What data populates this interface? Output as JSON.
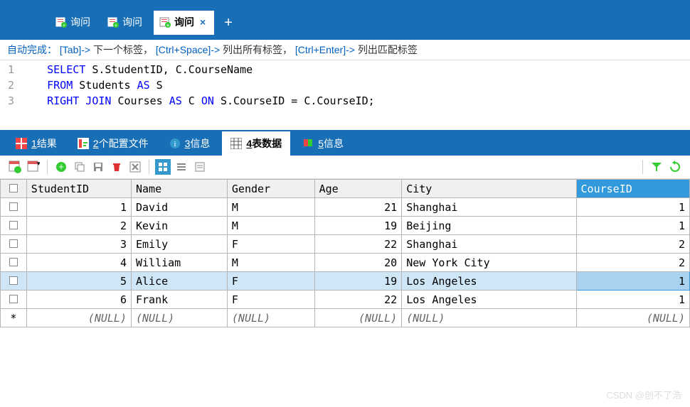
{
  "tabs": [
    {
      "label": "询问",
      "active": false
    },
    {
      "label": "询问",
      "active": false
    },
    {
      "label": "询问",
      "active": true
    }
  ],
  "hint": {
    "prefix": "自动完成：",
    "t1": "[Tab]->",
    "l1": " 下一个标签，",
    "t2": "[Ctrl+Space]->",
    "l2": " 列出所有标签，",
    "t3": "[Ctrl+Enter]->",
    "l3": " 列出匹配标签"
  },
  "sql": {
    "line1": {
      "kw1": "SELECT",
      "rest": " S.StudentID, C.CourseName"
    },
    "line2": {
      "kw1": "FROM",
      "mid": " Students ",
      "kw2": "AS",
      "rest": " S"
    },
    "line3": {
      "kw1": "RIGHT JOIN",
      "mid": " Courses ",
      "kw2": "AS",
      "mid2": " C ",
      "kw3": "ON",
      "rest": " S.CourseID = C.CourseID;"
    }
  },
  "result_tabs": {
    "t1": {
      "num": "1",
      "label": " 结果"
    },
    "t2": {
      "num": "2",
      "label": " 个配置文件"
    },
    "t3": {
      "num": "3",
      "label": " 信息"
    },
    "t4": {
      "num": "4",
      "label": " 表数据"
    },
    "t5": {
      "num": "5",
      "label": " 信息"
    }
  },
  "columns": {
    "c1": "StudentID",
    "c2": "Name",
    "c3": "Gender",
    "c4": "Age",
    "c5": "City",
    "c6": "CourseID"
  },
  "rows": [
    {
      "id": "1",
      "name": "David",
      "gender": "M",
      "age": "21",
      "city": "Shanghai",
      "course": "1",
      "sel": false
    },
    {
      "id": "2",
      "name": "Kevin",
      "gender": "M",
      "age": "19",
      "city": "Beijing",
      "course": "1",
      "sel": false
    },
    {
      "id": "3",
      "name": "Emily",
      "gender": "F",
      "age": "22",
      "city": "Shanghai",
      "course": "2",
      "sel": false
    },
    {
      "id": "4",
      "name": "William",
      "gender": "M",
      "age": "20",
      "city": "New York City",
      "course": "2",
      "sel": false
    },
    {
      "id": "5",
      "name": "Alice",
      "gender": "F",
      "age": "19",
      "city": "Los Angeles",
      "course": "1",
      "sel": true
    },
    {
      "id": "6",
      "name": "Frank",
      "gender": "F",
      "age": "22",
      "city": "Los Angeles",
      "course": "1",
      "sel": false
    }
  ],
  "null_label": "(NULL)",
  "star": "*",
  "watermark": "CSDN @创不了浩"
}
